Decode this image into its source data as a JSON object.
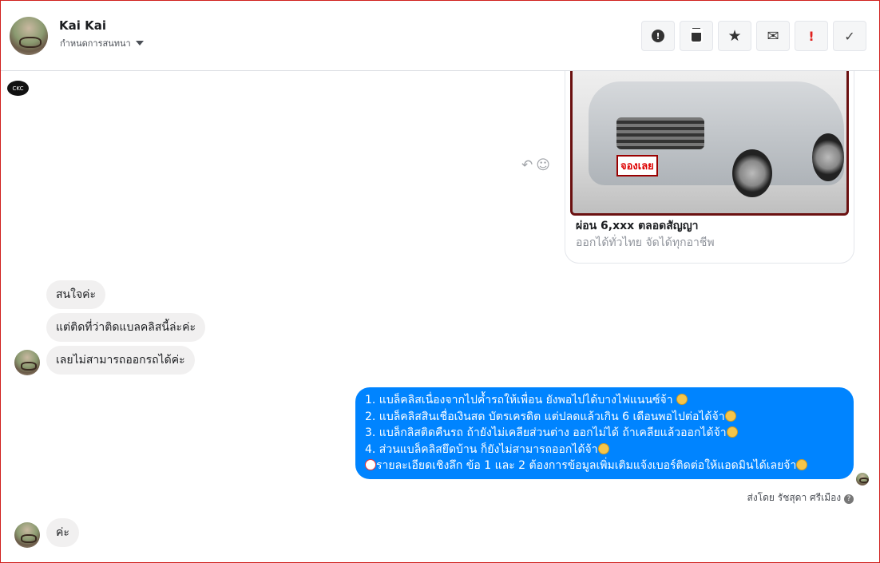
{
  "header": {
    "name": "Kai Kai",
    "subtitle": "กำหนดการสนทนา"
  },
  "toolbar": [
    {
      "icon": "alert-circle-icon",
      "glyph": "❶"
    },
    {
      "icon": "trash-icon",
      "glyph": "🗑"
    },
    {
      "icon": "star-icon",
      "glyph": "★"
    },
    {
      "icon": "envelope-icon",
      "glyph": "✉"
    },
    {
      "icon": "important-icon",
      "glyph": "!"
    },
    {
      "icon": "check-icon",
      "glyph": "✓"
    }
  ],
  "logo_text": "CKC",
  "card": {
    "image_badge": "จองเลย",
    "title": "ผ่อน 6,xxx ตลอดสัญญา",
    "subtitle": "ออกได้ทั่วไทย จัดได้ทุกอาชีพ"
  },
  "incoming": [
    "สนใจค่ะ",
    "แต่ติดที่ว่าติดแบลคลิสนี้ล่ะค่ะ",
    "เลยไม่สามารถออกรถได้ค่ะ"
  ],
  "outgoing": {
    "lines": [
      "1. แบล็คลิสเนื่องจากไปค้ำรถให้เพื่อน ยังพอไปได้บางไฟแนนซ์จ้า ",
      "2. แบล็คลิสสินเชื่อเงินสด บัตรเครดิต แต่ปลดแล้วเกิน 6 เดือนพอไปต่อได้จ้า",
      "3. แบล็กลิสติดคืนรถ ถ้ายังไม่เคลียส่วนต่าง ออกไม่ได้ ถ้าเคลียแล้วออกได้จ้า",
      "4. ส่วนแบล็คลิสยึดบ้าน ก็ยังไม่สามารถออกได้จ้า",
      "รายละเอียดเชิงลึก ข้อ 1 และ 2 ต้องการข้อมูลเพิ่มเติมแจ้งเบอร์ติดต่อให้แอดมินได้เลยจ้า"
    ],
    "sent_by": "ส่งโดย รัชสุดา ศรีเมือง"
  },
  "last_incoming": "ค่ะ"
}
